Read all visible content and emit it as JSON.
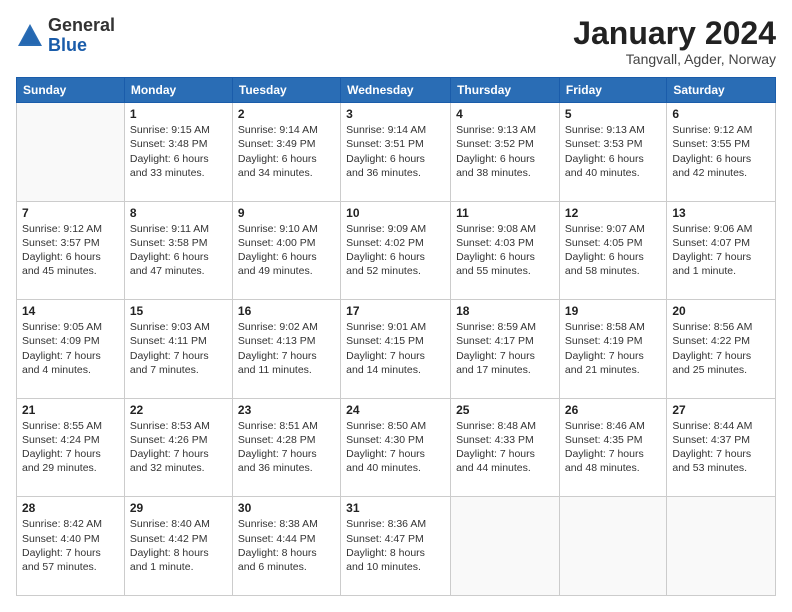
{
  "logo": {
    "general": "General",
    "blue": "Blue"
  },
  "header": {
    "month": "January 2024",
    "location": "Tangvall, Agder, Norway"
  },
  "columns": [
    "Sunday",
    "Monday",
    "Tuesday",
    "Wednesday",
    "Thursday",
    "Friday",
    "Saturday"
  ],
  "weeks": [
    [
      {
        "day": "",
        "info": ""
      },
      {
        "day": "1",
        "info": "Sunrise: 9:15 AM\nSunset: 3:48 PM\nDaylight: 6 hours\nand 33 minutes."
      },
      {
        "day": "2",
        "info": "Sunrise: 9:14 AM\nSunset: 3:49 PM\nDaylight: 6 hours\nand 34 minutes."
      },
      {
        "day": "3",
        "info": "Sunrise: 9:14 AM\nSunset: 3:51 PM\nDaylight: 6 hours\nand 36 minutes."
      },
      {
        "day": "4",
        "info": "Sunrise: 9:13 AM\nSunset: 3:52 PM\nDaylight: 6 hours\nand 38 minutes."
      },
      {
        "day": "5",
        "info": "Sunrise: 9:13 AM\nSunset: 3:53 PM\nDaylight: 6 hours\nand 40 minutes."
      },
      {
        "day": "6",
        "info": "Sunrise: 9:12 AM\nSunset: 3:55 PM\nDaylight: 6 hours\nand 42 minutes."
      }
    ],
    [
      {
        "day": "7",
        "info": "Sunrise: 9:12 AM\nSunset: 3:57 PM\nDaylight: 6 hours\nand 45 minutes."
      },
      {
        "day": "8",
        "info": "Sunrise: 9:11 AM\nSunset: 3:58 PM\nDaylight: 6 hours\nand 47 minutes."
      },
      {
        "day": "9",
        "info": "Sunrise: 9:10 AM\nSunset: 4:00 PM\nDaylight: 6 hours\nand 49 minutes."
      },
      {
        "day": "10",
        "info": "Sunrise: 9:09 AM\nSunset: 4:02 PM\nDaylight: 6 hours\nand 52 minutes."
      },
      {
        "day": "11",
        "info": "Sunrise: 9:08 AM\nSunset: 4:03 PM\nDaylight: 6 hours\nand 55 minutes."
      },
      {
        "day": "12",
        "info": "Sunrise: 9:07 AM\nSunset: 4:05 PM\nDaylight: 6 hours\nand 58 minutes."
      },
      {
        "day": "13",
        "info": "Sunrise: 9:06 AM\nSunset: 4:07 PM\nDaylight: 7 hours\nand 1 minute."
      }
    ],
    [
      {
        "day": "14",
        "info": "Sunrise: 9:05 AM\nSunset: 4:09 PM\nDaylight: 7 hours\nand 4 minutes."
      },
      {
        "day": "15",
        "info": "Sunrise: 9:03 AM\nSunset: 4:11 PM\nDaylight: 7 hours\nand 7 minutes."
      },
      {
        "day": "16",
        "info": "Sunrise: 9:02 AM\nSunset: 4:13 PM\nDaylight: 7 hours\nand 11 minutes."
      },
      {
        "day": "17",
        "info": "Sunrise: 9:01 AM\nSunset: 4:15 PM\nDaylight: 7 hours\nand 14 minutes."
      },
      {
        "day": "18",
        "info": "Sunrise: 8:59 AM\nSunset: 4:17 PM\nDaylight: 7 hours\nand 17 minutes."
      },
      {
        "day": "19",
        "info": "Sunrise: 8:58 AM\nSunset: 4:19 PM\nDaylight: 7 hours\nand 21 minutes."
      },
      {
        "day": "20",
        "info": "Sunrise: 8:56 AM\nSunset: 4:22 PM\nDaylight: 7 hours\nand 25 minutes."
      }
    ],
    [
      {
        "day": "21",
        "info": "Sunrise: 8:55 AM\nSunset: 4:24 PM\nDaylight: 7 hours\nand 29 minutes."
      },
      {
        "day": "22",
        "info": "Sunrise: 8:53 AM\nSunset: 4:26 PM\nDaylight: 7 hours\nand 32 minutes."
      },
      {
        "day": "23",
        "info": "Sunrise: 8:51 AM\nSunset: 4:28 PM\nDaylight: 7 hours\nand 36 minutes."
      },
      {
        "day": "24",
        "info": "Sunrise: 8:50 AM\nSunset: 4:30 PM\nDaylight: 7 hours\nand 40 minutes."
      },
      {
        "day": "25",
        "info": "Sunrise: 8:48 AM\nSunset: 4:33 PM\nDaylight: 7 hours\nand 44 minutes."
      },
      {
        "day": "26",
        "info": "Sunrise: 8:46 AM\nSunset: 4:35 PM\nDaylight: 7 hours\nand 48 minutes."
      },
      {
        "day": "27",
        "info": "Sunrise: 8:44 AM\nSunset: 4:37 PM\nDaylight: 7 hours\nand 53 minutes."
      }
    ],
    [
      {
        "day": "28",
        "info": "Sunrise: 8:42 AM\nSunset: 4:40 PM\nDaylight: 7 hours\nand 57 minutes."
      },
      {
        "day": "29",
        "info": "Sunrise: 8:40 AM\nSunset: 4:42 PM\nDaylight: 8 hours\nand 1 minute."
      },
      {
        "day": "30",
        "info": "Sunrise: 8:38 AM\nSunset: 4:44 PM\nDaylight: 8 hours\nand 6 minutes."
      },
      {
        "day": "31",
        "info": "Sunrise: 8:36 AM\nSunset: 4:47 PM\nDaylight: 8 hours\nand 10 minutes."
      },
      {
        "day": "",
        "info": ""
      },
      {
        "day": "",
        "info": ""
      },
      {
        "day": "",
        "info": ""
      }
    ]
  ]
}
